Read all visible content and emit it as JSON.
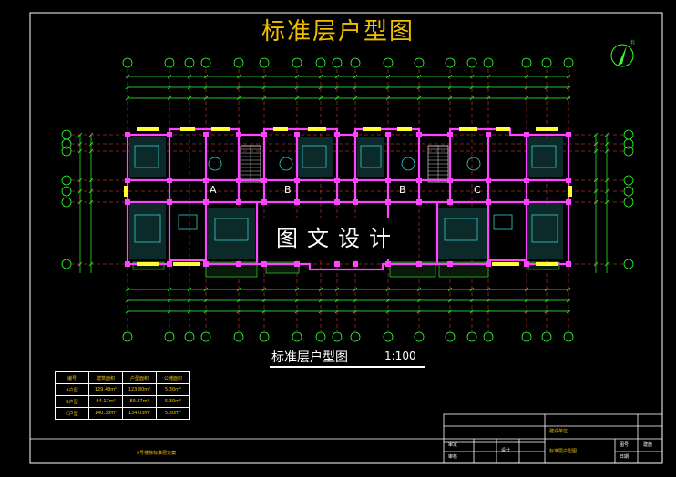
{
  "drawing": {
    "title": "标准层户型图",
    "subtitle": "标准层户型图",
    "scale": "1:100",
    "watermark": "图文设计",
    "north_mark": "北",
    "footer_note": "5号楼栋标准层方案"
  },
  "area_table": {
    "headers": [
      "编号",
      "建筑面积",
      "户型面积",
      "公摊面积"
    ],
    "rows": [
      [
        "A户型",
        "129.48m²",
        "123.80m²",
        "5.30m²"
      ],
      [
        "B户型",
        "94.17m²",
        "89.87m²",
        "5.30m²"
      ],
      [
        "C户型",
        "140.33m²",
        "134.03m²",
        "5.30m²"
      ]
    ]
  },
  "title_block": {
    "project_label": "建设单位",
    "drawing_name": "标准层户型图",
    "col_1": "审定",
    "col_2": "审核",
    "col_3": "设计",
    "col_4": "图号",
    "col_5": "日期",
    "value_1": "建施"
  },
  "unit_labels": [
    "A",
    "B",
    "B",
    "C"
  ],
  "colors": {
    "background": "#000000",
    "title": "#f0c000",
    "wall": "#ff44ff",
    "dimension": "#33ff33",
    "furniture": "#33cccc",
    "window": "#ffff33",
    "border": "#ffffff"
  }
}
